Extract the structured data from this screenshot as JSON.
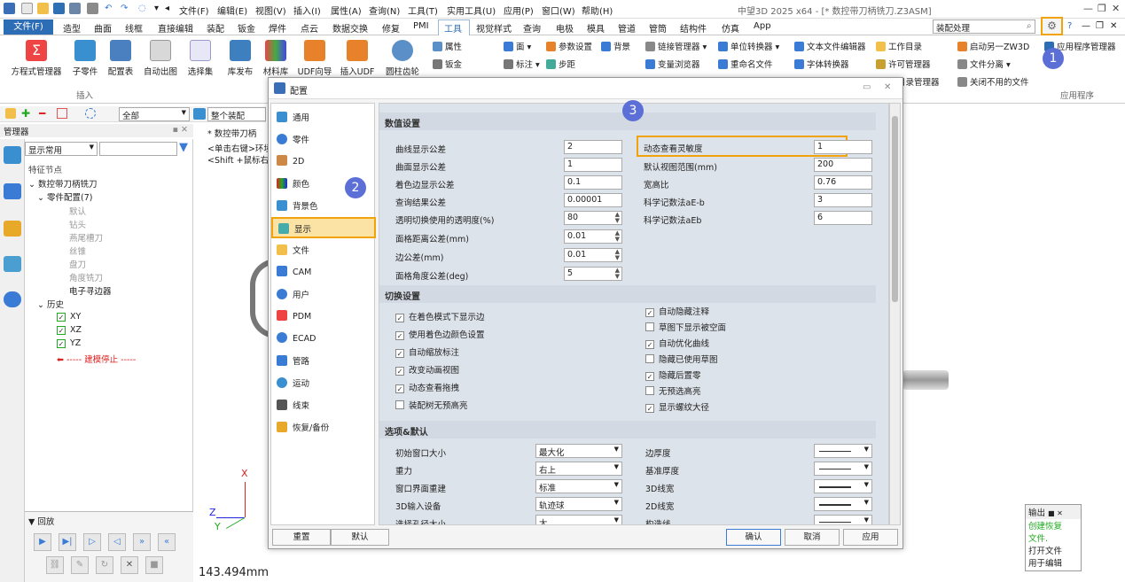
{
  "app": {
    "window_title": "中望3D 2025 x64 - [* 数控带刀柄铣刀.Z3ASM]"
  },
  "menu": [
    "文件(F)",
    "编辑(E)",
    "视图(V)",
    "插入(I)",
    "属性(A)",
    "查询(N)",
    "工具(T)",
    "实用工具(U)",
    "应用(P)",
    "窗口(W)",
    "帮助(H)"
  ],
  "tabs": [
    "文件(F)",
    "造型",
    "曲面",
    "线框",
    "直接编辑",
    "装配",
    "钣金",
    "焊件",
    "点云",
    "数据交换",
    "修复",
    "PMI",
    "工具",
    "视觉样式",
    "查询",
    "电极",
    "模具",
    "管道",
    "管筒",
    "结构件",
    "仿真",
    "App"
  ],
  "search": {
    "value": "装配处理"
  },
  "ribbon": {
    "big": [
      "方程式管理器",
      "子零件",
      "配置表",
      "自动出图",
      "选择集",
      "库发布",
      "材料库",
      "UDF向导",
      "插入UDF",
      "圆柱齿轮"
    ],
    "group_insert": "插入",
    "small": [
      "属性",
      "钣金",
      "面",
      "标注",
      "参数设置",
      "背景",
      "步距",
      "链接管理器",
      "变量浏览器",
      "单位转换器",
      "重命名文件",
      "文本文件编辑器",
      "字体转换器",
      "工作目录",
      "许可管理器",
      "启动另一ZW3D",
      "文件分离",
      "目录管理器",
      "关闭不用的文件",
      "应用程序管理器"
    ],
    "group_app": "应用程序"
  },
  "toolbar2": {
    "filter": "全部",
    "assembly": "整个装配"
  },
  "manager": {
    "title": "管理器",
    "display": "显示常用",
    "feature_node": "特征节点",
    "tree": [
      {
        "label": "数控带刀柄铣刀",
        "grey": false
      },
      {
        "label": "零件配置(7)",
        "grey": false
      },
      {
        "label": "默认",
        "grey": true
      },
      {
        "label": "钻头",
        "grey": true
      },
      {
        "label": "燕尾槽刀",
        "grey": true
      },
      {
        "label": "丝锥",
        "grey": true
      },
      {
        "label": "盘刀",
        "grey": true
      },
      {
        "label": "角度铣刀",
        "grey": true
      },
      {
        "label": "电子寻边器",
        "grey": false
      },
      {
        "label": "历史",
        "grey": false
      },
      {
        "label": "XY",
        "grey": false
      },
      {
        "label": "XZ",
        "grey": false
      },
      {
        "label": "YZ",
        "grey": false
      },
      {
        "label": "----- 建模停止 -----",
        "grey": false
      }
    ],
    "playback": "回放"
  },
  "canvas": {
    "hint1": "* 数控带刀柄",
    "hint2": "<单击右键>环境",
    "hint3": "<Shift +鼠标右",
    "measure": "143.494mm",
    "axis_x": "X",
    "axis_y": "Y",
    "axis_z": "Z"
  },
  "dialog": {
    "title": "配置",
    "nav": [
      "通用",
      "零件",
      "2D",
      "颜色",
      "背景色",
      "显示",
      "文件",
      "CAM",
      "用户",
      "PDM",
      "ECAD",
      "管路",
      "运动",
      "线束",
      "恢复/备份"
    ],
    "sec_numeric": "数值设置",
    "numeric_left": [
      {
        "label": "曲线显示公差",
        "value": "2",
        "spin": false
      },
      {
        "label": "曲面显示公差",
        "value": "1",
        "spin": false
      },
      {
        "label": "着色边显示公差",
        "value": "0.1",
        "spin": false
      },
      {
        "label": "查询结果公差",
        "value": "0.00001",
        "spin": false
      },
      {
        "label": "透明切换使用的透明度(%)",
        "value": "80",
        "spin": true
      },
      {
        "label": "面格距离公差(mm)",
        "value": "0.01",
        "spin": true
      },
      {
        "label": "边公差(mm)",
        "value": "0.01",
        "spin": true
      },
      {
        "label": "面格角度公差(deg)",
        "value": "5",
        "spin": true
      }
    ],
    "numeric_right": [
      {
        "label": "动态查看灵敏度",
        "value": "1"
      },
      {
        "label": "默认视图范围(mm)",
        "value": "200"
      },
      {
        "label": "宽高比",
        "value": "0.76"
      },
      {
        "label": "科学记数法aE-b",
        "value": "3"
      },
      {
        "label": "科学记数法aEb",
        "value": "6"
      }
    ],
    "sec_switch": "切换设置",
    "switch_left": [
      {
        "label": "在着色模式下显示边",
        "checked": true
      },
      {
        "label": "使用着色边颜色设置",
        "checked": true
      },
      {
        "label": "自动缩放标注",
        "checked": true
      },
      {
        "label": "改变动画视图",
        "checked": true
      },
      {
        "label": "动态查看拖拽",
        "checked": true
      },
      {
        "label": "装配树无预高亮",
        "checked": false
      }
    ],
    "switch_right": [
      {
        "label": "自动隐藏注释",
        "checked": true
      },
      {
        "label": "草图下显示被空面",
        "checked": false
      },
      {
        "label": "自动优化曲线",
        "checked": true
      },
      {
        "label": "隐藏已使用草图",
        "checked": false
      },
      {
        "label": "隐藏后置零",
        "checked": true
      },
      {
        "label": "无预选高亮",
        "checked": false
      },
      {
        "label": "显示螺纹大径",
        "checked": true
      }
    ],
    "sec_options": "选项&默认",
    "options_left": [
      {
        "label": "初始窗口大小",
        "value": "最大化"
      },
      {
        "label": "重力",
        "value": "右上"
      },
      {
        "label": "窗口界面重建",
        "value": "标准"
      },
      {
        "label": "3D输入设备",
        "value": "轨迹球"
      },
      {
        "label": "选择孔径大小",
        "value": "大"
      }
    ],
    "options_right": [
      "边厚度",
      "基准厚度",
      "3D线宽",
      "2D线宽",
      "构造线"
    ],
    "buttons": {
      "reset": "重置",
      "default": "默认",
      "ok": "确认",
      "cancel": "取消",
      "apply": "应用"
    }
  },
  "output": {
    "title": "输出",
    "lines": [
      "创建恢复",
      "文件.",
      "打开文件",
      "用于编辑"
    ]
  },
  "badges": [
    "1",
    "2",
    "3"
  ]
}
